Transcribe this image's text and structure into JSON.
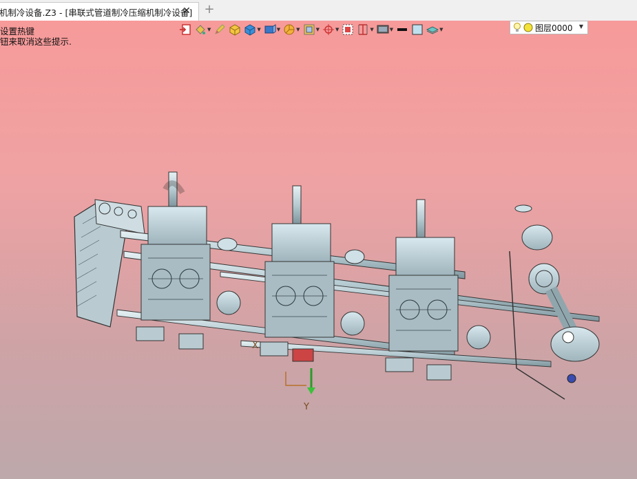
{
  "tab": {
    "title": "机制冷设备.Z3 - [串联式管道制冷压缩机制冷设备]",
    "close_symbol": "✕",
    "add_symbol": "+"
  },
  "hints": {
    "line1": "设置热键",
    "line2": "钮来取消这些提示."
  },
  "toolbar": {
    "icons": [
      "exit-icon",
      "paint-bucket-icon",
      "pencil-icon",
      "shaded-cube-icon",
      "blue-cube-icon",
      "view-cube-icon",
      "pie-render-icon",
      "frame-icon",
      "crosshair-icon",
      "dashed-square-icon",
      "bracket-icon",
      "monitor-icon",
      "line-weight-icon",
      "color-swatch-icon",
      "layer-stack-icon"
    ],
    "layer_name": "图层0000",
    "accent": "#3a78c8"
  },
  "axes": {
    "x_label": "X",
    "y_label": "Y"
  }
}
